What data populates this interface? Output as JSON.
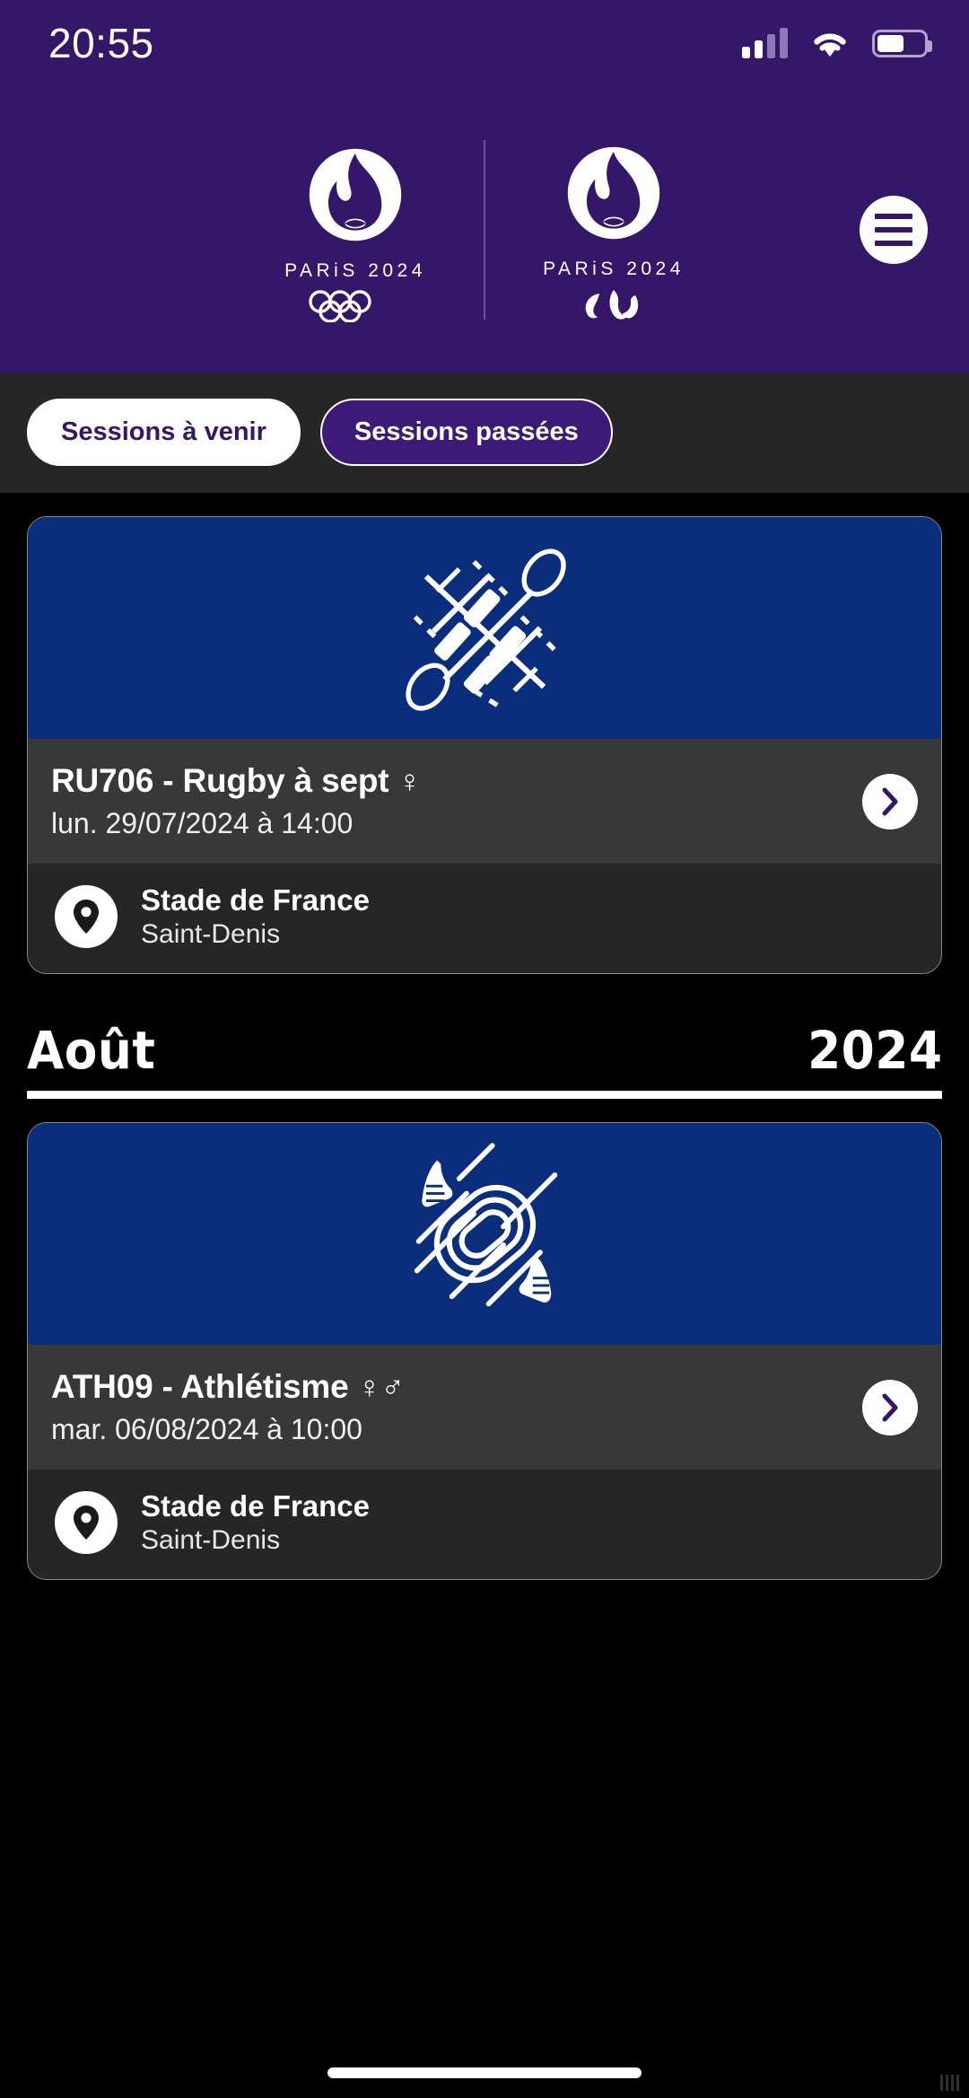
{
  "status_bar": {
    "time": "20:55",
    "signal_icon": "cellular-signal-icon",
    "wifi_icon": "wifi-icon",
    "battery_icon": "battery-icon"
  },
  "header": {
    "olympic_logo": {
      "wordmark": "PARiS 2024",
      "mark_icon": "paris2024-flame-marianne-icon",
      "symbol_icon": "olympic-rings-icon"
    },
    "paralympic_logo": {
      "wordmark": "PARiS 2024",
      "mark_icon": "paris2024-flame-marianne-icon",
      "symbol_icon": "paralympic-agitos-icon"
    },
    "menu_icon": "hamburger-menu-icon",
    "background_color": "#35176a"
  },
  "tabs": [
    {
      "label": "Sessions à venir",
      "selected": false,
      "style": "light"
    },
    {
      "label": "Sessions passées",
      "selected": true,
      "style": "dark"
    }
  ],
  "sessions": [
    {
      "pictogram_icon": "rugby-sevens-pictogram",
      "title": "RU706 - Rugby à sept",
      "gender": "♀",
      "date": "lun. 29/07/2024 à 14:00",
      "venue_name": "Stade de France",
      "venue_city": "Saint-Denis",
      "pin_icon": "location-pin-icon",
      "chevron_icon": "chevron-right-icon",
      "hero_color": "#0a2d7c"
    }
  ],
  "month_header": {
    "month": "Août",
    "year": "2024"
  },
  "sessions_august": [
    {
      "pictogram_icon": "athletics-pictogram",
      "title": "ATH09 - Athlétisme",
      "gender": "♀♂",
      "date": "mar. 06/08/2024 à 10:00",
      "venue_name": "Stade de France",
      "venue_city": "Saint-Denis",
      "pin_icon": "location-pin-icon",
      "chevron_icon": "chevron-right-icon",
      "hero_color": "#0a2d7c"
    }
  ],
  "colors": {
    "brand_purple": "#35176a",
    "tab_active_purple": "#3d1a78",
    "hero_navy": "#0a2d7c",
    "card_info_gray": "#383838",
    "card_venue_gray": "#262626",
    "page_black": "#000000"
  }
}
